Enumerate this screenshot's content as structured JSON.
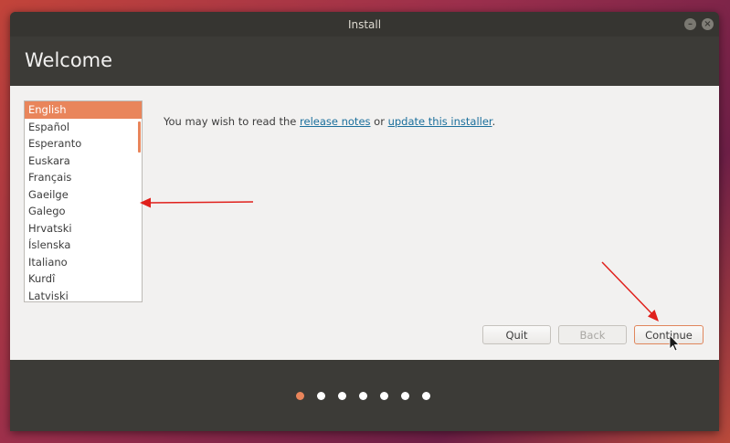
{
  "window": {
    "title": "Install",
    "minimize_glyph": "–",
    "close_glyph": "×"
  },
  "page": {
    "title": "Welcome"
  },
  "languages": [
    "English",
    "Español",
    "Esperanto",
    "Euskara",
    "Français",
    "Gaeilge",
    "Galego",
    "Hrvatski",
    "Íslenska",
    "Italiano",
    "Kurdî",
    "Latviski"
  ],
  "selected_language": "English",
  "notes": {
    "prefix": "You may wish to read the ",
    "release_link": "release notes",
    "middle": " or ",
    "update_link": "update this installer",
    "suffix": "."
  },
  "buttons": {
    "quit": "Quit",
    "back": "Back",
    "continue": "Continue"
  },
  "progress": {
    "total_steps": 7,
    "current_step": 1
  },
  "colors": {
    "accent": "#e9855b",
    "annotation": "#e0201b"
  }
}
